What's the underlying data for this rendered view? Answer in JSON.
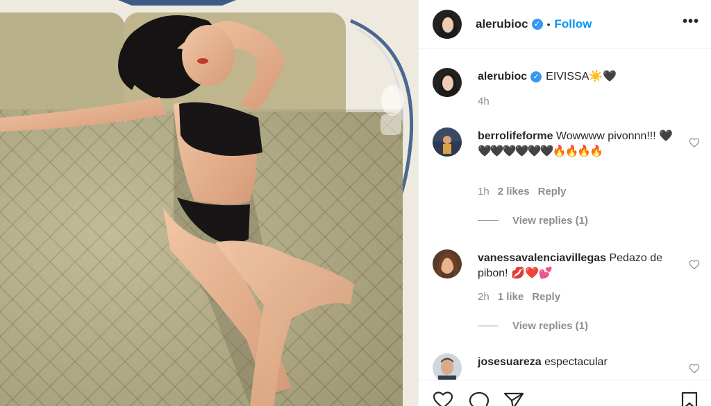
{
  "post": {
    "username": "alerubioc",
    "follow_label": "Follow",
    "separator": "•",
    "more_icon": "•••"
  },
  "caption": {
    "username": "alerubioc",
    "text": "EIVISSA",
    "emoji": "☀️🖤",
    "time": "4h"
  },
  "comments": [
    {
      "username": "berrolifeforme",
      "text": "Wowwww pivonnn!!!",
      "emoji": "🖤🖤🖤🖤🖤🖤🖤🔥🔥🔥🔥",
      "time": "1h",
      "likes": "2 likes",
      "reply": "Reply",
      "view_replies": "View replies (1)"
    },
    {
      "username": "vanessavalenciavillegas",
      "text": "Pedazo de pibon!",
      "emoji": "💋❤️💕",
      "time": "2h",
      "likes": "1 like",
      "reply": "Reply",
      "view_replies": "View replies (1)"
    },
    {
      "username": "josesuareza",
      "text": "espectacular"
    }
  ],
  "colors": {
    "link": "#0095f6",
    "verified": "#3897f0",
    "muted": "#8e8e8e",
    "text": "#262626"
  },
  "icons": [
    "verified-badge-icon",
    "more-options-icon",
    "heart-icon",
    "comment-icon",
    "share-icon",
    "bookmark-icon"
  ]
}
